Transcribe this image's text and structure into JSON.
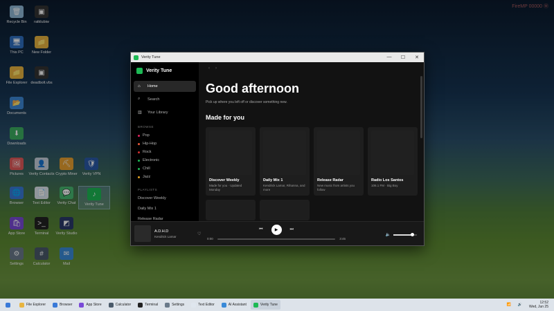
{
  "watermark": "FireMP 00000 Ⓜ",
  "desktop_icons": [
    {
      "label": "Recycle Bin",
      "icon": "recycle-bin-icon",
      "color": "#8fb8d8",
      "glyph": "🗑"
    },
    {
      "label": "ratklubiw",
      "icon": "terminal-app-icon",
      "color": "#333",
      "glyph": "▣"
    },
    {
      "label": "This PC",
      "icon": "monitor-icon",
      "color": "#2f6fc0",
      "glyph": "🖥"
    },
    {
      "label": "New Folder",
      "icon": "folder-icon",
      "color": "#e8b440",
      "glyph": "📁"
    },
    {
      "label": "File Explorer",
      "icon": "folder-icon",
      "color": "#e8b440",
      "glyph": "📁"
    },
    {
      "label": "deadbolt.vbs",
      "icon": "script-file-icon",
      "color": "#333",
      "glyph": "▣"
    },
    {
      "label": "Documents",
      "icon": "documents-folder-icon",
      "color": "#3d88d6",
      "glyph": "📂"
    },
    {
      "label": "Downloads",
      "icon": "downloads-folder-icon",
      "color": "#3cae62",
      "glyph": "⬇"
    },
    {
      "label": "Pictures",
      "icon": "pictures-icon",
      "color": "#e25a5a",
      "glyph": "🖼"
    },
    {
      "label": "Verity Contacts",
      "icon": "contacts-icon",
      "color": "#c8d2de",
      "glyph": "👤"
    },
    {
      "label": "Crypto Miner",
      "icon": "crypto-miner-icon",
      "color": "#e8a030",
      "glyph": "⛏"
    },
    {
      "label": "Verity VPN",
      "icon": "vpn-shield-icon",
      "color": "#2a5aa8",
      "glyph": "🛡"
    },
    {
      "label": "Browser",
      "icon": "browser-icon",
      "color": "#3a7ad8",
      "glyph": "🌐"
    },
    {
      "label": "Text Editor",
      "icon": "text-editor-icon",
      "color": "#dfe6ee",
      "glyph": "📄"
    },
    {
      "label": "Verity Chat",
      "icon": "chat-icon",
      "color": "#48b870",
      "glyph": "💬"
    },
    {
      "label": "Verity Tune",
      "icon": "music-app-icon",
      "color": "#1db954",
      "glyph": "♪"
    },
    {
      "label": "App Store",
      "icon": "app-store-icon",
      "color": "#7a4ad8",
      "glyph": "🛍"
    },
    {
      "label": "Terminal",
      "icon": "terminal-icon",
      "color": "#222",
      "glyph": ">_"
    },
    {
      "label": "Verity Studio",
      "icon": "studio-icon",
      "color": "#2a3a6a",
      "glyph": "◩"
    },
    {
      "label": "Settings",
      "icon": "gear-icon",
      "color": "#6a7a8a",
      "glyph": "⚙"
    },
    {
      "label": "Calculator",
      "icon": "calculator-icon",
      "color": "#4a5a6a",
      "glyph": "#"
    },
    {
      "label": "Mail",
      "icon": "mail-icon",
      "color": "#3a8ad8",
      "glyph": "✉"
    }
  ],
  "window": {
    "title": "Verity Tune",
    "controls": [
      "—",
      "☐",
      "✕"
    ]
  },
  "app": {
    "brand": "Verity Tune",
    "nav": [
      {
        "label": "Home",
        "glyph": "⌂"
      },
      {
        "label": "Search",
        "glyph": "⌕"
      },
      {
        "label": "Your Library",
        "glyph": "▥"
      }
    ],
    "browse_heading": "BROWSE",
    "genres": [
      {
        "label": "Pop",
        "color": "#e0245e"
      },
      {
        "label": "Hip-Hop",
        "color": "#e8593a"
      },
      {
        "label": "Rock",
        "color": "#d03030"
      },
      {
        "label": "Electronic",
        "color": "#1db954"
      },
      {
        "label": "Chill",
        "color": "#1db954"
      },
      {
        "label": "Jazz",
        "color": "#e0a020"
      }
    ],
    "playlists_heading": "PLAYLISTS",
    "playlists": [
      "Discover Weekly",
      "Daily Mix 1",
      "Release Radar"
    ],
    "greeting": "Good afternoon",
    "subtitle": "Pick up where you left off or discover something new.",
    "made_for_you": "Made for you",
    "cards": [
      {
        "title": "Discover Weekly",
        "desc": "Made for you · Updated Monday"
      },
      {
        "title": "Daily Mix 1",
        "desc": "Kendrick Lamar, Rihanna, and more"
      },
      {
        "title": "Release Radar",
        "desc": "New music from artists you follow"
      },
      {
        "title": "Radio Los Santos",
        "desc": "106.1 FM · Big Boy"
      },
      {
        "title": "",
        "desc": ""
      },
      {
        "title": "",
        "desc": ""
      }
    ]
  },
  "player": {
    "track": "A.D.H.D",
    "artist": "Kendrick Lamar",
    "elapsed": "0:00",
    "duration": "3:45",
    "progress": 0.0,
    "volume": 0.8
  },
  "taskbar": {
    "items": [
      {
        "label": "File Explorer",
        "color": "#e8b440"
      },
      {
        "label": "Browser",
        "color": "#3a7ad8"
      },
      {
        "label": "App Store",
        "color": "#7a4ad8"
      },
      {
        "label": "Calculator",
        "color": "#4a5a6a"
      },
      {
        "label": "Terminal",
        "color": "#222"
      },
      {
        "label": "Settings",
        "color": "#6a7a8a"
      },
      {
        "label": "Text Editor",
        "color": "#dfe6ee"
      },
      {
        "label": "AI Assistant",
        "color": "#3a8ad8"
      },
      {
        "label": "Verity Tune",
        "color": "#1db954"
      }
    ],
    "time": "12:52",
    "date": "Wed, Jun 25"
  }
}
